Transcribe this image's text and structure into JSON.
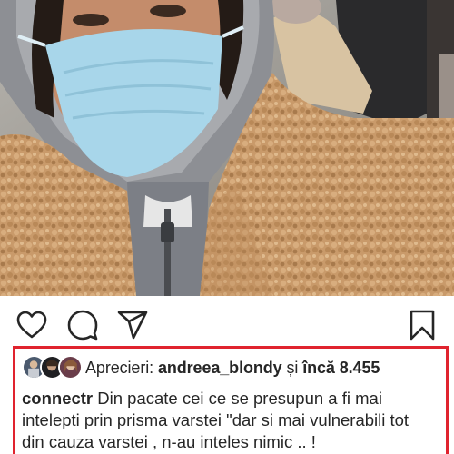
{
  "post": {
    "photo_icon": "photo",
    "actions": {
      "like_icon": "heart-icon",
      "comment_icon": "comment-icon",
      "share_icon": "paper-plane-icon",
      "save_icon": "bookmark-icon"
    },
    "likes": {
      "label": "Aprecieri:",
      "user": "andreea_blondy",
      "conjunction": "și",
      "more": "încă 8.455"
    },
    "caption": {
      "user": "connectr",
      "line1": "Din  pacate cei ce se presupun a fi mai",
      "line2": "intelepti prin prisma varstei \"dar si mai vulnerabili tot",
      "line3": "din cauza varstei , n-au inteles nimic .. !"
    },
    "colors": {
      "highlight_border": "#e0232e",
      "text": "#262626"
    }
  }
}
